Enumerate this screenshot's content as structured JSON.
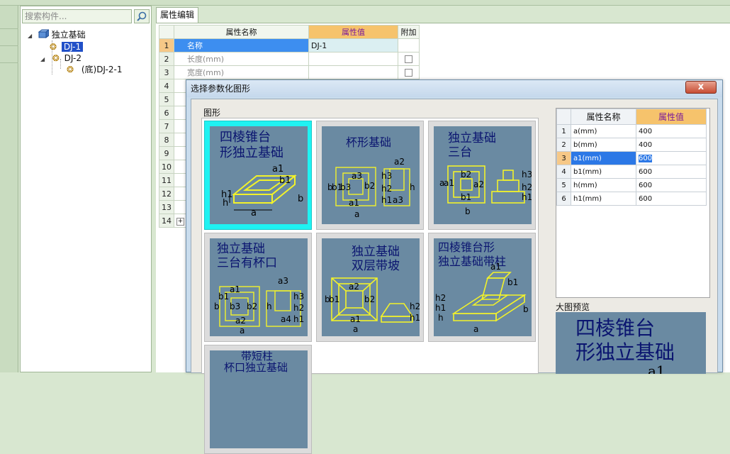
{
  "tree": {
    "search_placeholder": "搜索构件...",
    "root": "独立基础",
    "items": [
      "DJ-1",
      "DJ-2",
      "(底)DJ-2-1"
    ]
  },
  "editor": {
    "tab": "属性编辑",
    "headers": [
      "属性名称",
      "属性值",
      "附加"
    ],
    "rows": [
      {
        "num": "1",
        "name": "名称",
        "value": "DJ-1"
      },
      {
        "num": "2",
        "name": "长度(mm)",
        "value": ""
      },
      {
        "num": "3",
        "name": "宽度(mm)",
        "value": ""
      },
      {
        "num": "4"
      },
      {
        "num": "5"
      },
      {
        "num": "6"
      },
      {
        "num": "7"
      },
      {
        "num": "8"
      },
      {
        "num": "9"
      },
      {
        "num": "10"
      },
      {
        "num": "11"
      },
      {
        "num": "12"
      },
      {
        "num": "13"
      },
      {
        "num": "14"
      }
    ]
  },
  "dialog": {
    "title": "选择参数化图形",
    "close": "x",
    "group_label": "图形",
    "shapes": [
      {
        "line1": "四棱锥台",
        "line2": "形独立基础"
      },
      {
        "line1": "杯形基础",
        "line2": ""
      },
      {
        "line1": "独立基础",
        "line2": "三台"
      },
      {
        "line1": "独立基础",
        "line2": "三台有杯口"
      },
      {
        "line1": "独立基础",
        "line2": "双层带坡"
      },
      {
        "line1": "四棱锥台形",
        "line2": "独立基础带柱"
      },
      {
        "line1": "带短柱",
        "line2": "杯口独立基础"
      }
    ],
    "params": {
      "headers": [
        "属性名称",
        "属性值"
      ],
      "rows": [
        {
          "num": "1",
          "name": "a(mm)",
          "value": "400"
        },
        {
          "num": "2",
          "name": "b(mm)",
          "value": "400"
        },
        {
          "num": "3",
          "name": "a1(mm)",
          "value": "600"
        },
        {
          "num": "4",
          "name": "b1(mm)",
          "value": "600"
        },
        {
          "num": "5",
          "name": "h(mm)",
          "value": "600"
        },
        {
          "num": "6",
          "name": "h1(mm)",
          "value": "600"
        }
      ]
    },
    "preview_label": "大图预览",
    "preview_line1": "四棱锥台",
    "preview_line2": "形独立基础",
    "preview_dim": "a1"
  },
  "colors": {
    "tile_bg": "#6a8aa2",
    "drawing": "#f2f22a",
    "title_text": "#0b1570",
    "selected_tile": "#1ff2f2",
    "header_value": "#f6c36c"
  }
}
